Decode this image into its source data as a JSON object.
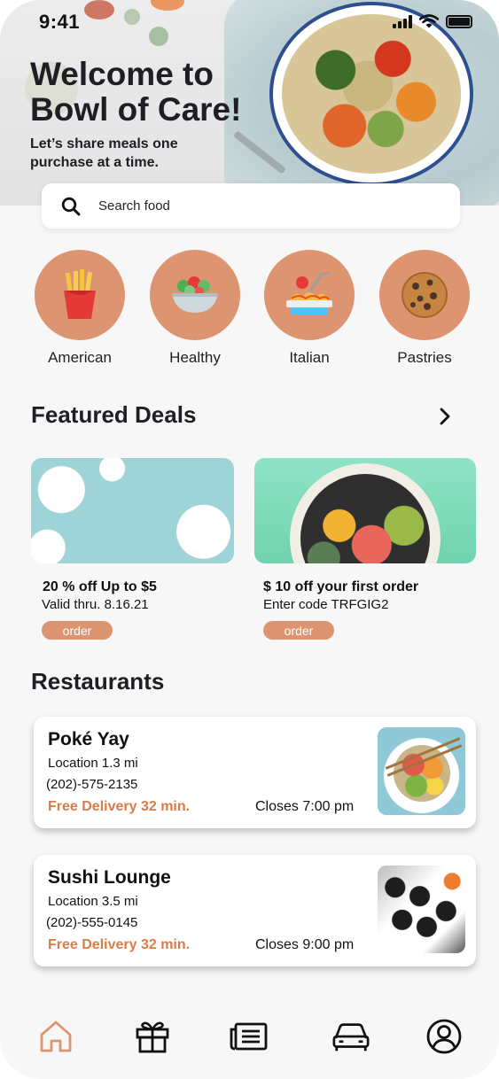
{
  "status_bar": {
    "time": "9:41"
  },
  "hero": {
    "title_line1": "Welcome to",
    "title_line2": "Bowl of Care!",
    "subtitle_line1": "Let’s share meals one",
    "subtitle_line2": "purchase at a time."
  },
  "search": {
    "placeholder": "Search food"
  },
  "categories": [
    {
      "label": "American",
      "icon": "fries-icon"
    },
    {
      "label": "Healthy",
      "icon": "salad-icon"
    },
    {
      "label": "Italian",
      "icon": "pasta-icon"
    },
    {
      "label": "Pastries",
      "icon": "cookie-icon"
    }
  ],
  "featured": {
    "title": "Featured Deals",
    "deals": [
      {
        "title": "20 % off Up to $5",
        "subtitle": "Valid thru. 8.16.21",
        "button": "order"
      },
      {
        "title": "$ 10 off your first order",
        "subtitle": "Enter code TRFGIG2",
        "button": "order"
      }
    ]
  },
  "restaurants": {
    "title": "Restaurants",
    "items": [
      {
        "name": "Poké Yay",
        "location": "Location 1.3 mi",
        "phone": "(202)-575-2135",
        "delivery": "Free Delivery 32 min.",
        "closes": "Closes  7:00 pm"
      },
      {
        "name": "Sushi Lounge",
        "location": "Location 3.5 mi",
        "phone": "(202)-555-0145",
        "delivery": "Free Delivery 32 min.",
        "closes": "Closes  9:00 pm"
      }
    ]
  },
  "nav": [
    "home-icon",
    "gift-icon",
    "news-icon",
    "car-icon",
    "profile-icon"
  ],
  "colors": {
    "accent": "#dd9470",
    "delivery": "#d97c47",
    "nav_active": "#dd9470",
    "text": "#1e1e24"
  }
}
